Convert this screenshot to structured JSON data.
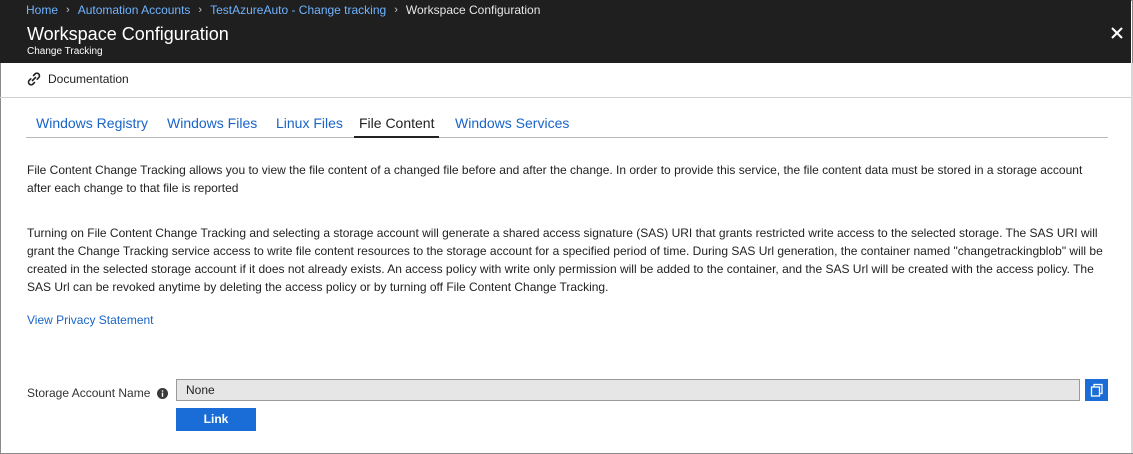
{
  "breadcrumb": {
    "items": [
      "Home",
      "Automation Accounts",
      "TestAzureAuto - Change tracking"
    ],
    "current": "Workspace Configuration"
  },
  "header": {
    "title": "Workspace Configuration",
    "subtitle": "Change Tracking",
    "close_icon": "close-icon"
  },
  "toolbar": {
    "documentation_label": "Documentation",
    "documentation_icon": "link-icon"
  },
  "tabs": [
    {
      "label": "Windows Registry",
      "active": false
    },
    {
      "label": "Windows Files",
      "active": false
    },
    {
      "label": "Linux Files",
      "active": false
    },
    {
      "label": "File Content",
      "active": true
    },
    {
      "label": "Windows Services",
      "active": false
    }
  ],
  "content": {
    "description": "File Content Change Tracking allows you to view the file content of a changed file before and after the change. In order to provide this service, the file content data must be stored in a storage account after each change to that file is reported",
    "sas_explanation": "Turning on File Content Change Tracking and selecting a storage account will generate a shared access signature (SAS) URI that grants restricted write access to the selected storage. The SAS URI will grant the Change Tracking service access to write file content resources to the storage account for a specified period of time. During SAS Url generation, the container named \"changetrackingblob\" will be created in the selected storage account if it does not already exists. An access policy with write only permission will be added to the container, and the SAS Url will be created with the access policy. The SAS Url can be revoked anytime by deleting the access policy or by turning off File Content Change Tracking.",
    "privacy_link": "View Privacy Statement"
  },
  "storage": {
    "label": "Storage Account Name",
    "value": "None",
    "info_icon": "info-icon",
    "copy_icon": "copy-icon",
    "link_button": "Link"
  },
  "colors": {
    "header_bg": "#1f1f1f",
    "link": "#1864c8",
    "breadcrumb_link": "#6fb3ff",
    "primary_button": "#1a6dd6",
    "input_bg": "#e6e6e6"
  }
}
